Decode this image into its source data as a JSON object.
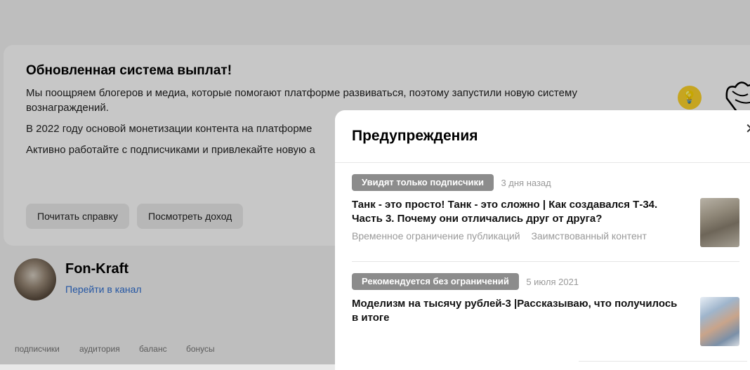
{
  "promo": {
    "title": "Обновленная система выплат!",
    "p1": "Мы поощряем блогеров и медиа, которые помогают платформе развиваться, поэтому запустили новую систему вознаграждений.",
    "p2": "В 2022 году основой монетизации контента на платформе",
    "p3": "Активно работайте с подписчиками и привлекайте новую а",
    "btn_help": "Почитать справку",
    "btn_income": "Посмотреть доход"
  },
  "channel": {
    "name": "Fon-Kraft",
    "link": "Перейти в канал"
  },
  "tabs": [
    "подписчики",
    "аудитория",
    "баланс",
    "бонусы"
  ],
  "modal": {
    "title": "Предупреждения",
    "items": [
      {
        "badge": "Увидят только подписчики",
        "date": "3 дня назад",
        "title": "Танк - это просто! Танк - это сложно | Как создавался Т-34. Часть 3. Почему они отличались друг от друга?",
        "tags": [
          "Временное ограничение публикаций",
          "Заимствованный контент"
        ]
      },
      {
        "badge": "Рекомендуется без ограничений",
        "date": "5 июля 2021",
        "title": "Моделизм на тысячу рублей-3 |Рассказываю, что получилось в итоге"
      }
    ]
  },
  "icons": {
    "bulb": "lightbulb-icon",
    "close": "close-icon"
  }
}
